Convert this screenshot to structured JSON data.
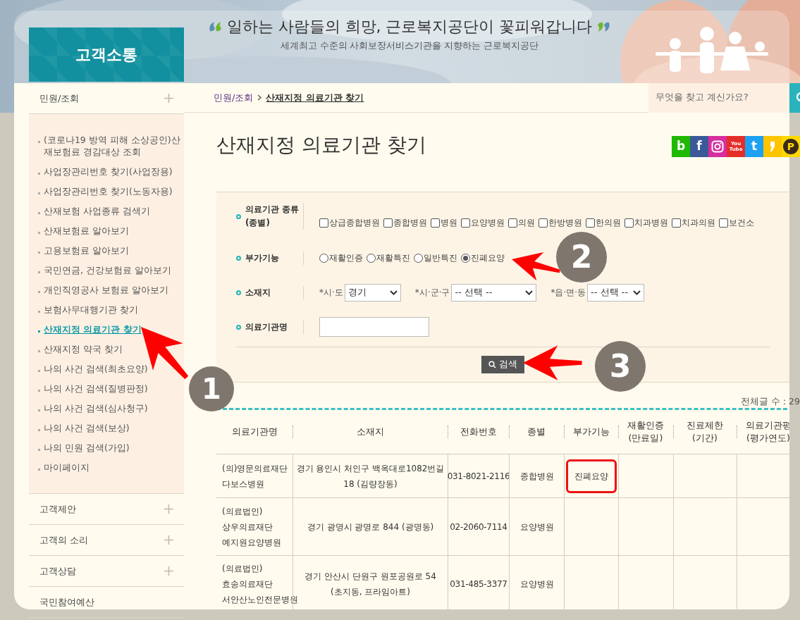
{
  "header": {
    "logo": "고객소통",
    "slogan": "일하는 사람들의 희망, 근로복지공단이 꽃피워갑니다",
    "subtitle": "세계최고 수준의 사회보장서비스기관을 지향하는 근로복지공단"
  },
  "sidebar": {
    "sections": [
      {
        "label": "민원/조회",
        "expandable": true,
        "expanded": true,
        "children": [
          {
            "label": "(코로나19 방역 피해 소상공인)산재보험료 경감대상 조회",
            "selected": false
          },
          {
            "label": "사업장관리번호 찾기(사업장용)",
            "selected": false
          },
          {
            "label": "사업장관리번호 찾기(노동자용)",
            "selected": false
          },
          {
            "label": "산재보험 사업종류 검색기",
            "selected": false
          },
          {
            "label": "산재보험료 알아보기",
            "selected": false
          },
          {
            "label": "고용보험료 알아보기",
            "selected": false
          },
          {
            "label": "국민연금, 건강보험료 알아보기",
            "selected": false
          },
          {
            "label": "개인직영공사 보험료 알아보기",
            "selected": false
          },
          {
            "label": "보험사무대행기관 찾기",
            "selected": false
          },
          {
            "label": "산재지정 의료기관 찾기",
            "selected": true
          },
          {
            "label": "산재지정 약국 찾기",
            "selected": false
          },
          {
            "label": "나의 사건 검색(최초요양)",
            "selected": false
          },
          {
            "label": "나의 사건 검색(질병판정)",
            "selected": false
          },
          {
            "label": "나의 사건 검색(심사청구)",
            "selected": false
          },
          {
            "label": "나의 사건 검색(보상)",
            "selected": false
          },
          {
            "label": "나의 민원 검색(가입)",
            "selected": false
          },
          {
            "label": "마이페이지",
            "selected": false
          }
        ]
      },
      {
        "label": "고객제안",
        "expandable": true,
        "expanded": false
      },
      {
        "label": "고객의 소리",
        "expandable": true,
        "expanded": false
      },
      {
        "label": "고객상담",
        "expandable": true,
        "expanded": false
      },
      {
        "label": "국민참여예산",
        "expandable": false,
        "expanded": false
      }
    ]
  },
  "breadcrumb": [
    {
      "label": "민원/조회",
      "current": false
    },
    {
      "label": "산재지정 의료기관 찾기",
      "current": true
    }
  ],
  "search": {
    "placeholder": "무엇을 찾고 계신가요?"
  },
  "page_title": "산재지정 의료기관 찾기",
  "social_links": [
    {
      "kind": "letter",
      "label": "b",
      "color": "#1fb900"
    },
    {
      "kind": "letter",
      "label": "f",
      "color": "#3b5998"
    },
    {
      "kind": "instagram",
      "color": "#d62e9f"
    },
    {
      "kind": "stack",
      "lines": [
        "You",
        "Tube"
      ],
      "color": "#e52d27"
    },
    {
      "kind": "letter",
      "label": "t",
      "color": "#1da1f2"
    },
    {
      "kind": "quote",
      "color": "#ffc400"
    },
    {
      "kind": "circle",
      "label": "P",
      "color": "#ffd800"
    }
  ],
  "form": {
    "fields": [
      {
        "kind": "checkboxes",
        "label": "의료기관 종류\n(종별)",
        "options": [
          {
            "label": "상급종합병원",
            "checked": false
          },
          {
            "label": "종합병원",
            "checked": false
          },
          {
            "label": "병원",
            "checked": false
          },
          {
            "label": "요양병원",
            "checked": false
          },
          {
            "label": "의원",
            "checked": false
          },
          {
            "label": "한방병원",
            "checked": false
          },
          {
            "label": "한의원",
            "checked": false
          },
          {
            "label": "치과병원",
            "checked": false
          },
          {
            "label": "치과의원",
            "checked": false
          },
          {
            "label": "보건소",
            "checked": false
          }
        ]
      },
      {
        "kind": "radios",
        "label": "부가기능",
        "options": [
          {
            "label": "재활인증",
            "selected": false
          },
          {
            "label": "재활특진",
            "selected": false
          },
          {
            "label": "일반특진",
            "selected": false
          },
          {
            "label": "진폐요양",
            "selected": true
          }
        ]
      },
      {
        "kind": "selects",
        "label": "소재지",
        "selects": [
          {
            "label": "*시·도",
            "value": "경기"
          },
          {
            "label": "*시·군·구",
            "value": "-- 선택 --"
          },
          {
            "label": "*읍·면·동",
            "value": "-- 선택 --"
          }
        ]
      },
      {
        "kind": "text",
        "label": "의료기관명"
      }
    ],
    "submit": "검색"
  },
  "results": {
    "count": "전체글 수 : 29"
  },
  "table": {
    "columns": [
      "의료기관명",
      "소재지",
      "전화번호",
      "종별",
      "부가기능",
      "재활인증\n(만료일)",
      "진료제한\n(기간)",
      "의료기관평\n(평가연도)"
    ],
    "rows": [
      {
        "name": "(의)영문의료재단 다보스병원",
        "address": "경기 용인시 처인구 백옥대로1082번길 18 (김량장동)",
        "phone": "031-8021-2116",
        "type": "종합병원",
        "feature": "진폐요양",
        "highlighted": true
      },
      {
        "name": "(의료법인)상우의료재단 예지원요양병원",
        "address": "경기 광명시 광명로 844 (광명동)",
        "phone": "02-2060-7114",
        "type": "요양병원",
        "highlighted": false
      },
      {
        "name": "(의료법인)효송의료재단 서안산노인전문병원",
        "address": "경기 안산시 단원구 원포공원로 54 (초지동, 프라임아트)",
        "phone": "031-485-3377",
        "type": "요양병원",
        "highlighted": false
      }
    ]
  },
  "annotations": [
    {
      "number": "1"
    },
    {
      "number": "2"
    },
    {
      "number": "3"
    }
  ]
}
